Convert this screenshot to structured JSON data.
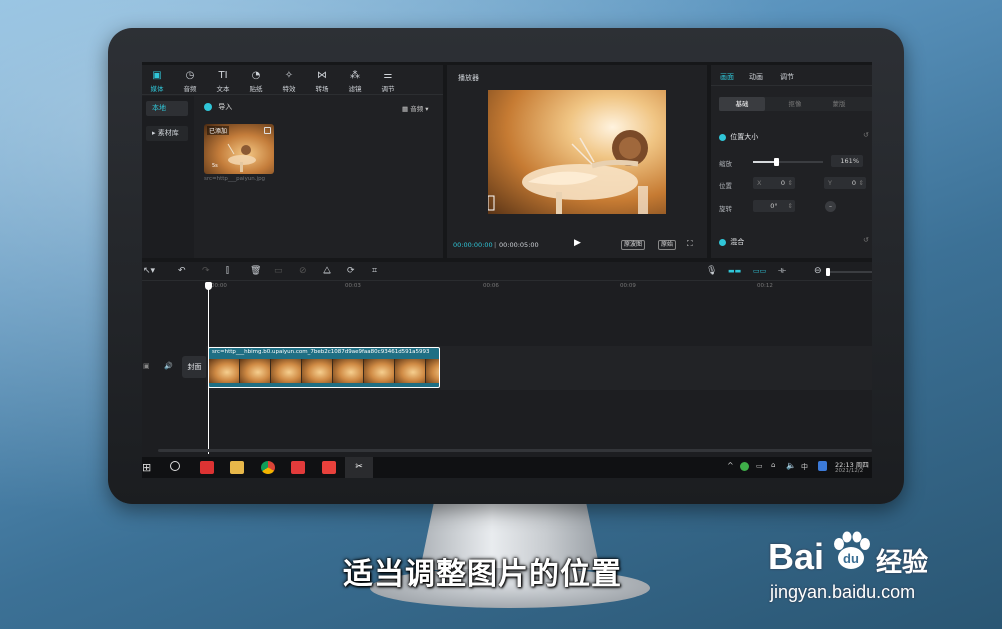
{
  "toolbar": {
    "items": [
      {
        "label": "媒体",
        "icon": "media-icon"
      },
      {
        "label": "音频",
        "icon": "audio-icon"
      },
      {
        "label": "文本",
        "icon": "text-icon"
      },
      {
        "label": "贴纸",
        "icon": "sticker-icon"
      },
      {
        "label": "特效",
        "icon": "effects-icon"
      },
      {
        "label": "转场",
        "icon": "transition-icon"
      },
      {
        "label": "滤镜",
        "icon": "filter-icon"
      },
      {
        "label": "调节",
        "icon": "adjust-icon"
      }
    ],
    "active_index": 0
  },
  "media_sidebar": {
    "local": "本地",
    "library": "素材库"
  },
  "media": {
    "import_label": "导入",
    "sort_label": "音频",
    "item": {
      "badge": "已添加",
      "duration": "5s",
      "filename": "src=http___paiyun.jpg"
    }
  },
  "player": {
    "title": "播放器",
    "current_time": "00:00:00:00",
    "total_time": "00:00:05:00",
    "btn_waveform": "原波图",
    "btn_ratio": "原始"
  },
  "properties": {
    "tabs": [
      "画面",
      "动画",
      "调节"
    ],
    "active_tab": 0,
    "subtabs": [
      "基础",
      "抠像",
      "蒙版"
    ],
    "active_subtab": 0,
    "section_position_size": "位置大小",
    "scale_label": "缩放",
    "scale_value": "161%",
    "scale_fraction": 0.33,
    "position_label": "位置",
    "pos_x_label": "X",
    "pos_x_value": "0",
    "pos_y_label": "Y",
    "pos_y_value": "0",
    "rotate_label": "旋转",
    "rotate_value": "0°",
    "section_blend": "混合"
  },
  "timeline": {
    "ruler": [
      "00:00",
      "00:03",
      "00:06",
      "00:09",
      "00:12"
    ],
    "cover_label": "封面",
    "clip_name": "src=http___hbimg.b0.upaiyun.com_7beb2c1087d9ae9faa80c93461d591a5993"
  },
  "taskbar": {
    "time": "22:13 周四",
    "date": "2021/12/2"
  },
  "overlay": {
    "subtitle": "适当调整图片的位置",
    "baidu_logo": "Bai",
    "baidu_logo2": "du",
    "baidu_jingyan": "经验",
    "baidu_url": "jingyan.baidu.com"
  },
  "colors": {
    "accent": "#30c6d8",
    "clip_border": "#ffffff",
    "clip_bar": "#1f6f84"
  }
}
